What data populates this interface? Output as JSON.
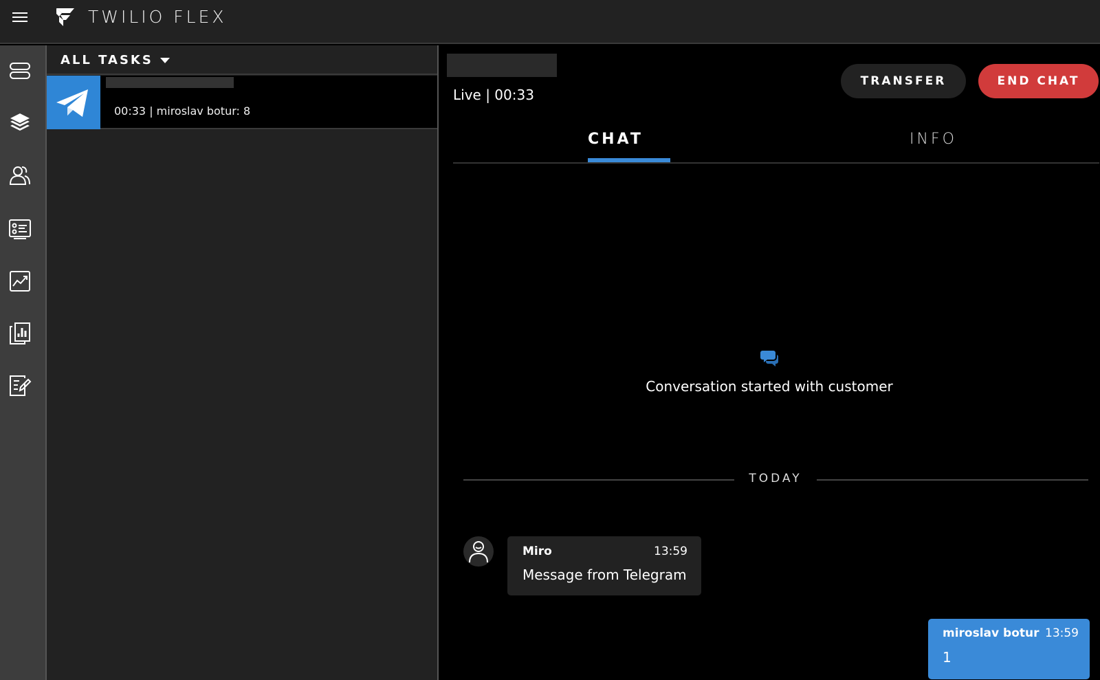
{
  "app": {
    "brand": "TWILIO FLEX"
  },
  "sidebar": {
    "items": [
      {
        "icon": "agent-desktop-icon"
      },
      {
        "icon": "layers-icon"
      },
      {
        "icon": "teams-icon"
      },
      {
        "icon": "queues-stats-icon"
      },
      {
        "icon": "analytics-icon"
      },
      {
        "icon": "dashboards-icon"
      },
      {
        "icon": "quality-management-icon"
      }
    ]
  },
  "tasks": {
    "filter_label": "ALL TASKS",
    "items": [
      {
        "channel_icon": "telegram-icon",
        "subtitle": "00:33 | miroslav botur: 8"
      }
    ]
  },
  "panel": {
    "status": "Live | 00:33",
    "transfer_label": "TRANSFER",
    "end_chat_label": "END CHAT",
    "tabs": [
      {
        "label": "CHAT",
        "active": true
      },
      {
        "label": "INFO",
        "active": false
      }
    ],
    "conversation_started": "Conversation started with customer",
    "day_divider": "TODAY",
    "messages": [
      {
        "author": "Miro",
        "time": "13:59",
        "text": "Message from Telegram",
        "direction": "inbound"
      },
      {
        "author": "miroslav botur",
        "time": "13:59",
        "text": "1",
        "direction": "outbound"
      }
    ]
  },
  "colors": {
    "accent": "#3a8ad8",
    "end_chat": "#d13b3b",
    "telegram": "#2f86d6"
  }
}
